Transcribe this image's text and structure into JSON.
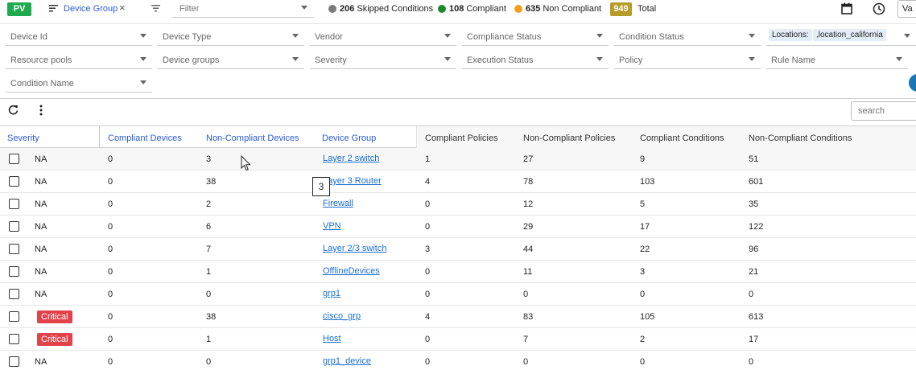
{
  "topbar": {
    "pv_badge": "PV",
    "device_group_label": "Device Group",
    "close_glyph": "×",
    "filter_placeholder": "Filter",
    "stats": [
      {
        "count": "206",
        "label": "Skipped Conditions",
        "color": "#7a7a7a"
      },
      {
        "count": "108",
        "label": "Compliant",
        "color": "#1e8a2e"
      },
      {
        "count": "635",
        "label": "Non Compliant",
        "color": "#f0a01e"
      }
    ],
    "total_count": "949",
    "total_label": "Total",
    "va_text": "Va"
  },
  "filters": {
    "row1": [
      "Device Id",
      "Device Type",
      "Vendor",
      "Compliance Status",
      "Condition Status"
    ],
    "locations_label": "Locations:",
    "locations_value": ",location_california",
    "row2": [
      "Resource pools",
      "Device groups",
      "Severity",
      "Execution Status",
      "Policy",
      "Rule Name"
    ],
    "row3": [
      "Condition Name"
    ]
  },
  "toolbar": {
    "search_placeholder": "search"
  },
  "table": {
    "headers": [
      "Severity",
      "Compliant Devices",
      "Non-Compliant Devices",
      "Device Group",
      "Compliant Policies",
      "Non-Compliant Policies",
      "Compliant Conditions",
      "Non-Compliant Conditions"
    ],
    "rows": [
      {
        "severity": "NA",
        "compliant_devices": "0",
        "non_compliant_devices": "3",
        "device_group": "Layer 2 switch",
        "compliant_policies": "1",
        "non_compliant_policies": "27",
        "compliant_conditions": "9",
        "non_compliant_conditions": "51"
      },
      {
        "severity": "NA",
        "compliant_devices": "0",
        "non_compliant_devices": "38",
        "device_group": "Layer 3 Router",
        "compliant_policies": "4",
        "non_compliant_policies": "78",
        "compliant_conditions": "103",
        "non_compliant_conditions": "601"
      },
      {
        "severity": "NA",
        "compliant_devices": "0",
        "non_compliant_devices": "2",
        "device_group": "Firewall",
        "compliant_policies": "0",
        "non_compliant_policies": "12",
        "compliant_conditions": "5",
        "non_compliant_conditions": "35"
      },
      {
        "severity": "NA",
        "compliant_devices": "0",
        "non_compliant_devices": "6",
        "device_group": "VPN",
        "compliant_policies": "0",
        "non_compliant_policies": "29",
        "compliant_conditions": "17",
        "non_compliant_conditions": "122"
      },
      {
        "severity": "NA",
        "compliant_devices": "0",
        "non_compliant_devices": "7",
        "device_group": "Layer 2/3 switch",
        "compliant_policies": "3",
        "non_compliant_policies": "44",
        "compliant_conditions": "22",
        "non_compliant_conditions": "96"
      },
      {
        "severity": "NA",
        "compliant_devices": "0",
        "non_compliant_devices": "1",
        "device_group": "OfflineDevices",
        "compliant_policies": "0",
        "non_compliant_policies": "11",
        "compliant_conditions": "3",
        "non_compliant_conditions": "21"
      },
      {
        "severity": "NA",
        "compliant_devices": "0",
        "non_compliant_devices": "0",
        "device_group": "grp1",
        "compliant_policies": "0",
        "non_compliant_policies": "0",
        "compliant_conditions": "0",
        "non_compliant_conditions": "0"
      },
      {
        "severity": "Critical",
        "compliant_devices": "0",
        "non_compliant_devices": "38",
        "device_group": "cisco_grp",
        "compliant_policies": "4",
        "non_compliant_policies": "83",
        "compliant_conditions": "105",
        "non_compliant_conditions": "613"
      },
      {
        "severity": "Critical",
        "compliant_devices": "0",
        "non_compliant_devices": "1",
        "device_group": "Host",
        "compliant_policies": "0",
        "non_compliant_policies": "7",
        "compliant_conditions": "2",
        "non_compliant_conditions": "17"
      },
      {
        "severity": "NA",
        "compliant_devices": "0",
        "non_compliant_devices": "0",
        "device_group": "grp1_device",
        "compliant_policies": "0",
        "non_compliant_policies": "0",
        "compliant_conditions": "0",
        "non_compliant_conditions": "0"
      }
    ]
  },
  "tooltip_value": "3",
  "colors": {
    "pv": "#1faa4f",
    "accent": "#2a5bd7",
    "critical": "#e2434b",
    "total": "#b89c2a"
  }
}
